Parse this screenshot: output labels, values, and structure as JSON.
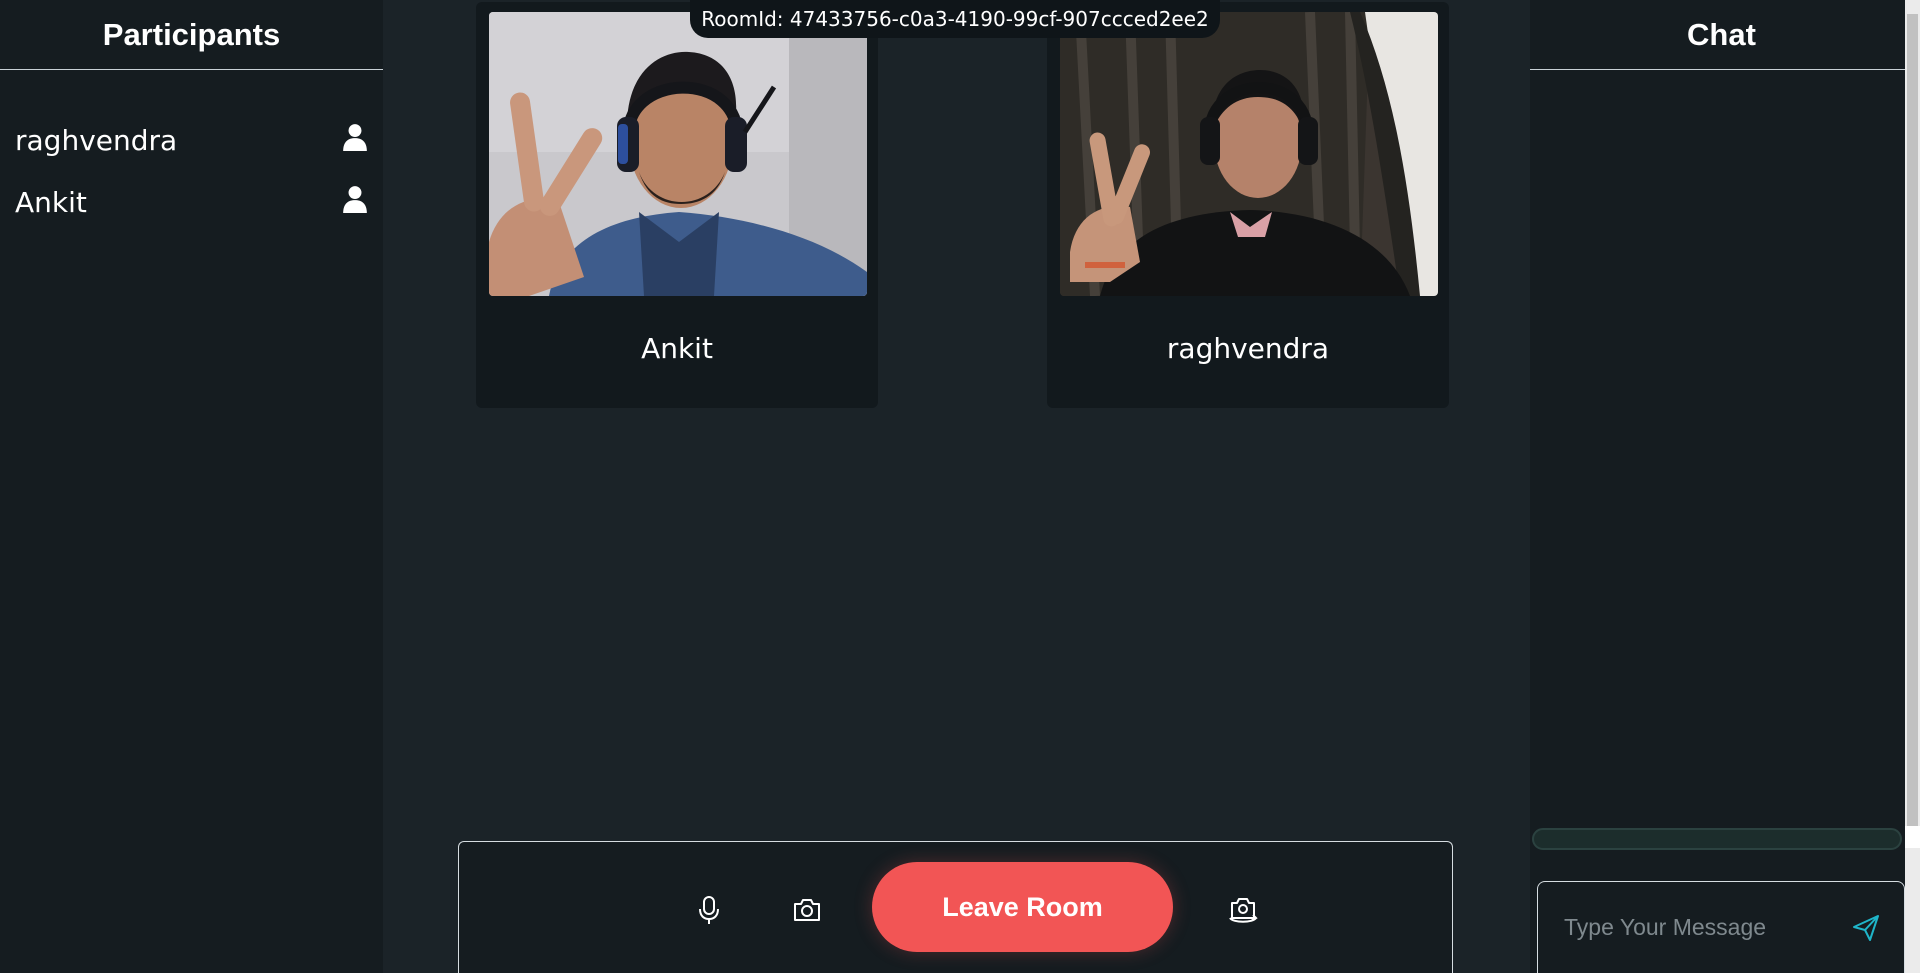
{
  "participants_panel": {
    "title": "Participants",
    "items": [
      {
        "name": "raghvendra",
        "icon": "user-icon"
      },
      {
        "name": "Ankit",
        "icon": "user-icon"
      }
    ]
  },
  "room": {
    "id_text": "RoomId: 47433756-c0a3-4190-99cf-907ccced2ee2"
  },
  "videos": [
    {
      "name": "Ankit"
    },
    {
      "name": "raghvendra"
    }
  ],
  "controls": {
    "mic_icon": "microphone-icon",
    "camera_icon": "camera-icon",
    "leave_label": "Leave Room",
    "switch_camera_icon": "switch-camera-icon"
  },
  "chat": {
    "title": "Chat",
    "input_placeholder": "Type Your Message",
    "send_icon": "send-icon"
  },
  "colors": {
    "leave_button": "#f25555",
    "panel_bg": "#151c20",
    "stage_bg": "#1b2328",
    "send_icon": "#1fb5c9"
  }
}
